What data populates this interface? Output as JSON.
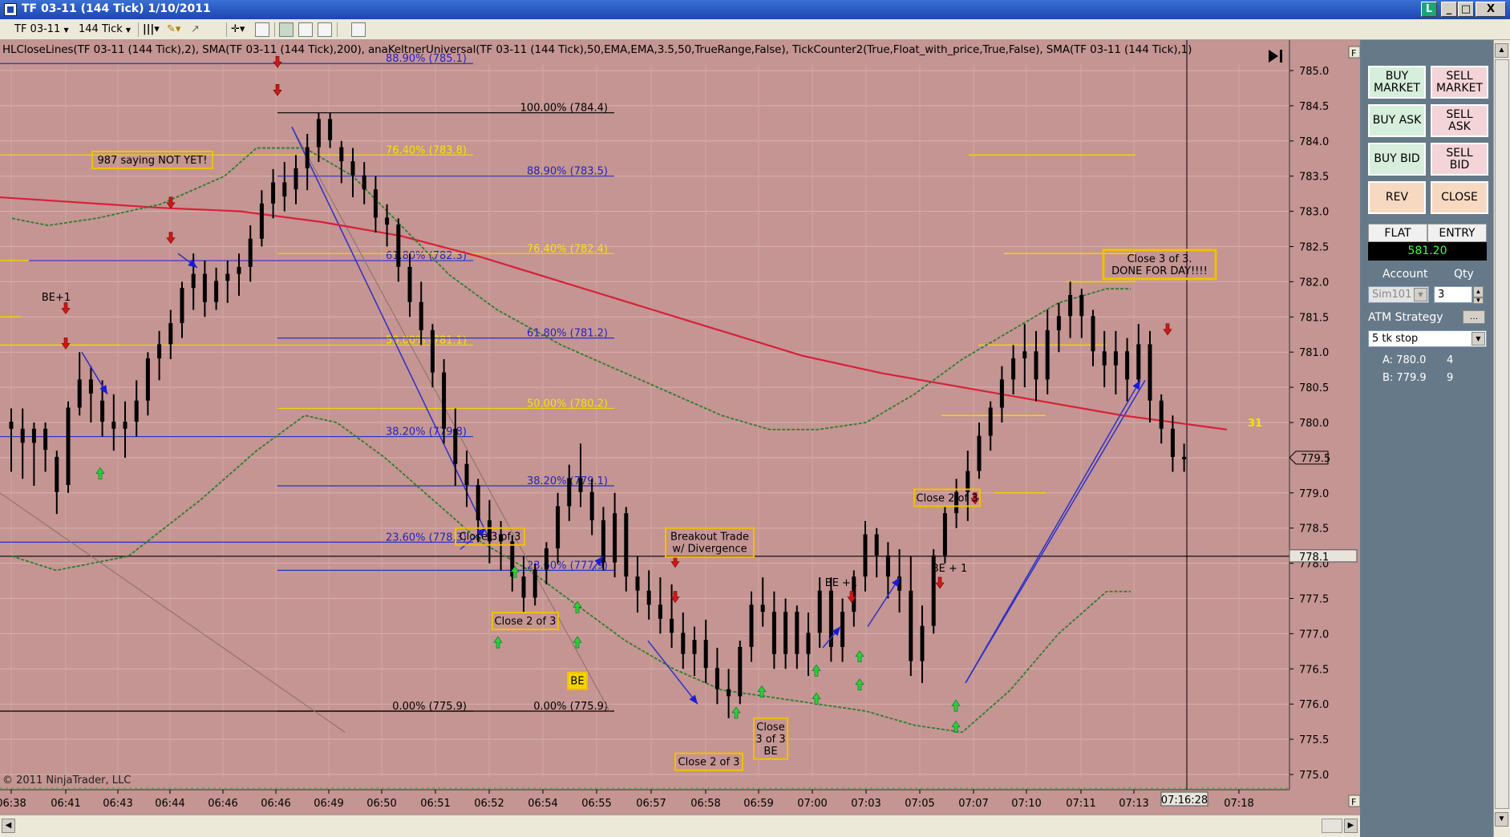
{
  "window": {
    "title": "TF 03-11 (144 Tick)  1/10/2011",
    "controls": [
      "L",
      "_",
      "□",
      "X"
    ]
  },
  "toolbar": {
    "instrument": "TF 03-11",
    "period": "144 Tick"
  },
  "chart": {
    "indicator_label": "HLCloseLines(TF  03-11  (144  Tick),2),  SMA(TF  03-11  (144  Tick),200),  anaKeltnerUniversal(TF  03-11  (144  Tick),50,EMA,EMA,3.5,50,TrueRange,False),  TickCounter2(True,Float_with_price,True,False),  SMA(TF  03-11  (144  Tick),1)",
    "copyright": "© 2011 NinjaTrader, LLC",
    "ticks_remaining": "31",
    "last_price": "779.5",
    "crosshair_price": "778.1",
    "crosshair_time": "07:16:28",
    "colors": {
      "background": "#c49592",
      "sma200": "#d8203a",
      "keltner": "#2e7d2e",
      "fib_gold": "#f2d500",
      "fib_blue": "#2e30c8"
    }
  },
  "chart_data": {
    "type": "candlestick",
    "ylim": [
      775.0,
      785.0
    ],
    "y_ticks": [
      "785.0",
      "784.5",
      "784.0",
      "783.5",
      "783.0",
      "782.5",
      "782.0",
      "781.5",
      "781.0",
      "780.5",
      "780.0",
      "779.5",
      "779.0",
      "778.5",
      "778.0",
      "777.5",
      "777.0",
      "776.5",
      "776.0",
      "775.5",
      "775.0"
    ],
    "x_ticks": [
      "06:38",
      "06:41",
      "06:43",
      "06:44",
      "06:46",
      "06:46",
      "06:49",
      "06:50",
      "06:51",
      "06:52",
      "06:54",
      "06:55",
      "06:57",
      "06:58",
      "06:59",
      "07:00",
      "07:03",
      "07:05",
      "07:07",
      "07:10",
      "07:11",
      "07:13",
      "07:16:28",
      "07:18"
    ],
    "fib_left": [
      {
        "label": "88.90% (785.1)",
        "price": 785.1,
        "color": "blue"
      },
      {
        "label": "76.40% (783.8)",
        "price": 783.8,
        "color": "gold"
      },
      {
        "label": "61.80% (782.3)",
        "price": 782.3,
        "color": "blue"
      },
      {
        "label": "50.00% (781.1)",
        "price": 781.1,
        "color": "gold"
      },
      {
        "label": "38.20% (779.8)",
        "price": 779.8,
        "color": "blue"
      },
      {
        "label": "23.60% (778.3)",
        "price": 778.3,
        "color": "blue"
      },
      {
        "label": "0.00% (775.9)",
        "price": 775.9,
        "color": "black"
      }
    ],
    "fib_right": [
      {
        "label": "100.00% (784.4)",
        "price": 784.4,
        "color": "black"
      },
      {
        "label": "88.90% (783.5)",
        "price": 783.5,
        "color": "blue"
      },
      {
        "label": "76.40% (782.4)",
        "price": 782.4,
        "color": "gold"
      },
      {
        "label": "61.80% (781.2)",
        "price": 781.2,
        "color": "blue"
      },
      {
        "label": "50.00% (780.2)",
        "price": 780.2,
        "color": "gold"
      },
      {
        "label": "38.20% (779.1)",
        "price": 779.1,
        "color": "blue"
      },
      {
        "label": "23.60% (777.9)",
        "price": 777.9,
        "color": "blue"
      },
      {
        "label": "0.00% (775.9)",
        "price": 775.9,
        "color": "black"
      }
    ],
    "annotations": [
      {
        "text": "987 saying NOT YET!"
      },
      {
        "text": "BE+1"
      },
      {
        "text": "Close 3 of 3"
      },
      {
        "text": "Close 2 of 3"
      },
      {
        "text": "BE"
      },
      {
        "text": "Breakout Trade\nw/ Divergence"
      },
      {
        "text": "Close 2 of 3"
      },
      {
        "text": "Close\n3 of 3\nBE"
      },
      {
        "text": "BE +1"
      },
      {
        "text": "BE + 1"
      },
      {
        "text": "Close 2 of 3"
      },
      {
        "text": "Close 3 of 3.\nDONE FOR DAY!!!!"
      }
    ],
    "bars": [
      [
        780.0,
        780.2,
        779.3,
        779.9
      ],
      [
        779.9,
        780.2,
        779.2,
        779.7
      ],
      [
        779.7,
        780.0,
        779.1,
        779.9
      ],
      [
        779.9,
        780.0,
        779.3,
        779.6
      ],
      [
        779.5,
        779.6,
        778.7,
        779.0
      ],
      [
        779.1,
        780.3,
        779.0,
        780.2
      ],
      [
        780.2,
        781.0,
        780.1,
        780.6
      ],
      [
        780.6,
        780.8,
        780.0,
        780.4
      ],
      [
        780.3,
        780.6,
        779.8,
        780.0
      ],
      [
        780.0,
        780.4,
        779.6,
        779.9
      ],
      [
        779.9,
        780.3,
        779.5,
        780.0
      ],
      [
        780.0,
        780.6,
        779.8,
        780.3
      ],
      [
        780.3,
        781.0,
        780.1,
        780.9
      ],
      [
        780.9,
        781.3,
        780.6,
        781.1
      ],
      [
        781.1,
        781.6,
        780.9,
        781.4
      ],
      [
        781.4,
        782.0,
        781.2,
        781.9
      ],
      [
        781.9,
        782.4,
        781.6,
        782.1
      ],
      [
        782.1,
        782.3,
        781.5,
        781.7
      ],
      [
        781.7,
        782.2,
        781.6,
        782.0
      ],
      [
        782.0,
        782.3,
        781.7,
        782.1
      ],
      [
        782.1,
        782.4,
        781.8,
        782.2
      ],
      [
        782.2,
        782.8,
        782.0,
        782.6
      ],
      [
        782.6,
        783.3,
        782.5,
        783.1
      ],
      [
        783.1,
        783.6,
        782.9,
        783.4
      ],
      [
        783.4,
        783.7,
        783.0,
        783.2
      ],
      [
        783.3,
        783.8,
        783.1,
        783.6
      ],
      [
        783.6,
        784.1,
        783.3,
        783.9
      ],
      [
        783.9,
        784.4,
        783.7,
        784.3
      ],
      [
        784.3,
        784.4,
        783.9,
        784.0
      ],
      [
        783.9,
        784.0,
        783.4,
        783.7
      ],
      [
        783.7,
        783.9,
        783.2,
        783.5
      ],
      [
        783.5,
        783.7,
        783.1,
        783.3
      ],
      [
        783.3,
        783.5,
        782.7,
        782.9
      ],
      [
        782.9,
        783.1,
        782.5,
        782.8
      ],
      [
        782.8,
        782.9,
        782.0,
        782.2
      ],
      [
        782.2,
        782.4,
        781.5,
        781.7
      ],
      [
        781.7,
        782.0,
        781.1,
        781.3
      ],
      [
        781.3,
        781.4,
        780.5,
        780.7
      ],
      [
        780.7,
        780.9,
        779.7,
        779.9
      ],
      [
        779.9,
        780.2,
        779.1,
        779.4
      ],
      [
        779.4,
        779.6,
        778.8,
        779.1
      ],
      [
        779.1,
        779.2,
        778.3,
        778.6
      ],
      [
        778.6,
        778.9,
        778.0,
        778.3
      ],
      [
        778.3,
        778.6,
        777.9,
        778.4
      ],
      [
        778.3,
        778.4,
        777.6,
        777.8
      ],
      [
        777.8,
        778.1,
        777.3,
        777.5
      ],
      [
        777.5,
        778.0,
        777.4,
        777.9
      ],
      [
        777.9,
        778.3,
        777.7,
        778.2
      ],
      [
        778.2,
        779.0,
        778.0,
        778.8
      ],
      [
        778.8,
        779.4,
        778.6,
        779.2
      ],
      [
        779.2,
        779.7,
        778.8,
        779.0
      ],
      [
        779.0,
        779.2,
        778.4,
        778.6
      ],
      [
        778.6,
        778.8,
        777.9,
        778.0
      ],
      [
        778.0,
        779.0,
        777.8,
        778.7
      ],
      [
        778.7,
        778.8,
        777.6,
        777.8
      ],
      [
        777.8,
        778.1,
        777.3,
        777.6
      ],
      [
        777.6,
        777.9,
        777.2,
        777.4
      ],
      [
        777.4,
        777.8,
        777.0,
        777.2
      ],
      [
        777.2,
        777.7,
        776.8,
        777.0
      ],
      [
        777.0,
        777.3,
        776.5,
        776.7
      ],
      [
        776.7,
        777.1,
        776.4,
        776.9
      ],
      [
        776.9,
        777.2,
        776.3,
        776.5
      ],
      [
        776.5,
        776.8,
        776.0,
        776.2
      ],
      [
        776.2,
        776.5,
        775.8,
        776.1
      ],
      [
        776.1,
        776.9,
        776.0,
        776.8
      ],
      [
        776.8,
        777.6,
        776.6,
        777.4
      ],
      [
        777.4,
        777.8,
        777.1,
        777.3
      ],
      [
        777.3,
        777.6,
        776.5,
        776.7
      ],
      [
        776.7,
        777.5,
        776.5,
        777.3
      ],
      [
        777.3,
        777.4,
        776.5,
        776.7
      ],
      [
        776.7,
        777.3,
        776.4,
        777.0
      ],
      [
        777.0,
        777.8,
        776.8,
        777.6
      ],
      [
        777.6,
        777.8,
        776.6,
        776.8
      ],
      [
        776.8,
        777.5,
        776.6,
        777.3
      ],
      [
        777.3,
        777.9,
        777.1,
        777.8
      ],
      [
        777.8,
        778.6,
        777.6,
        778.4
      ],
      [
        778.4,
        778.5,
        777.8,
        778.1
      ],
      [
        778.1,
        778.3,
        777.5,
        777.8
      ],
      [
        777.8,
        778.2,
        777.3,
        777.6
      ],
      [
        777.6,
        778.1,
        776.4,
        776.6
      ],
      [
        776.6,
        777.4,
        776.3,
        777.1
      ],
      [
        777.1,
        778.2,
        777.0,
        778.1
      ],
      [
        778.1,
        778.8,
        778.0,
        778.7
      ],
      [
        778.7,
        779.2,
        778.5,
        779.0
      ],
      [
        779.0,
        779.6,
        778.6,
        779.3
      ],
      [
        779.3,
        780.0,
        779.2,
        779.8
      ],
      [
        779.8,
        780.3,
        779.6,
        780.2
      ],
      [
        780.2,
        780.8,
        780.0,
        780.6
      ],
      [
        780.6,
        781.1,
        780.4,
        780.9
      ],
      [
        780.9,
        781.4,
        780.5,
        781.0
      ],
      [
        781.0,
        781.3,
        780.3,
        780.6
      ],
      [
        780.6,
        781.6,
        780.4,
        781.3
      ],
      [
        781.3,
        781.7,
        781.0,
        781.5
      ],
      [
        781.5,
        782.0,
        781.2,
        781.8
      ],
      [
        781.8,
        781.9,
        781.2,
        781.5
      ],
      [
        781.5,
        781.6,
        780.8,
        781.0
      ],
      [
        781.0,
        781.3,
        780.5,
        780.8
      ],
      [
        780.8,
        781.3,
        780.4,
        781.0
      ],
      [
        781.0,
        781.2,
        780.3,
        780.6
      ],
      [
        780.6,
        781.4,
        780.5,
        781.1
      ],
      [
        781.1,
        781.3,
        780.0,
        780.3
      ],
      [
        780.3,
        780.4,
        779.7,
        779.9
      ],
      [
        779.9,
        780.1,
        779.3,
        779.5
      ],
      [
        779.5,
        779.7,
        779.3,
        779.5
      ]
    ],
    "sma200": [
      [
        0,
        783.2
      ],
      [
        200,
        783.05
      ],
      [
        300,
        783.0
      ],
      [
        400,
        782.85
      ],
      [
        500,
        782.65
      ],
      [
        600,
        782.35
      ],
      [
        700,
        782.0
      ],
      [
        800,
        781.65
      ],
      [
        900,
        781.3
      ],
      [
        1000,
        780.95
      ],
      [
        1100,
        780.7
      ],
      [
        1200,
        780.5
      ],
      [
        1300,
        780.3
      ],
      [
        1400,
        780.1
      ],
      [
        1530,
        779.9
      ]
    ],
    "keltner_upper": [
      [
        15,
        782.9
      ],
      [
        60,
        782.8
      ],
      [
        120,
        782.9
      ],
      [
        200,
        783.1
      ],
      [
        280,
        783.5
      ],
      [
        320,
        783.9
      ],
      [
        380,
        783.9
      ],
      [
        440,
        783.5
      ],
      [
        500,
        782.8
      ],
      [
        560,
        782.1
      ],
      [
        620,
        781.6
      ],
      [
        700,
        781.1
      ],
      [
        760,
        780.8
      ],
      [
        840,
        780.4
      ],
      [
        900,
        780.1
      ],
      [
        960,
        779.9
      ],
      [
        1020,
        779.9
      ],
      [
        1080,
        780.0
      ],
      [
        1140,
        780.4
      ],
      [
        1200,
        780.9
      ],
      [
        1260,
        781.3
      ],
      [
        1320,
        781.7
      ],
      [
        1380,
        781.9
      ],
      [
        1410,
        781.9
      ]
    ],
    "keltner_lower": [
      [
        15,
        778.1
      ],
      [
        70,
        777.9
      ],
      [
        160,
        778.1
      ],
      [
        250,
        778.9
      ],
      [
        320,
        779.6
      ],
      [
        380,
        780.1
      ],
      [
        420,
        780.0
      ],
      [
        480,
        779.5
      ],
      [
        540,
        778.9
      ],
      [
        600,
        778.3
      ],
      [
        660,
        777.9
      ],
      [
        720,
        777.4
      ],
      [
        780,
        776.9
      ],
      [
        840,
        776.5
      ],
      [
        900,
        776.2
      ],
      [
        960,
        776.1
      ],
      [
        1020,
        776.0
      ],
      [
        1080,
        775.9
      ],
      [
        1140,
        775.7
      ],
      [
        1200,
        775.6
      ],
      [
        1260,
        776.2
      ],
      [
        1320,
        777.0
      ],
      [
        1380,
        777.6
      ],
      [
        1410,
        777.6
      ]
    ]
  },
  "panel": {
    "buy_market": "BUY\nMARKET",
    "sell_market": "SELL\nMARKET",
    "buy_ask": "BUY ASK",
    "sell_ask": "SELL\nASK",
    "buy_bid": "BUY BID",
    "sell_bid": "SELL\nBID",
    "rev": "REV",
    "close": "CLOSE",
    "flat": "FLAT",
    "entry": "ENTRY",
    "pnl": "581.20",
    "account_label": "Account",
    "qty_label": "Qty",
    "account": "Sim101",
    "qty": "3",
    "atm_label": "ATM Strategy",
    "atm_value": "5 tk stop",
    "a_label": "A: 780.0",
    "a_qty": "4",
    "b_label": "B: 779.9",
    "b_qty": "9"
  }
}
